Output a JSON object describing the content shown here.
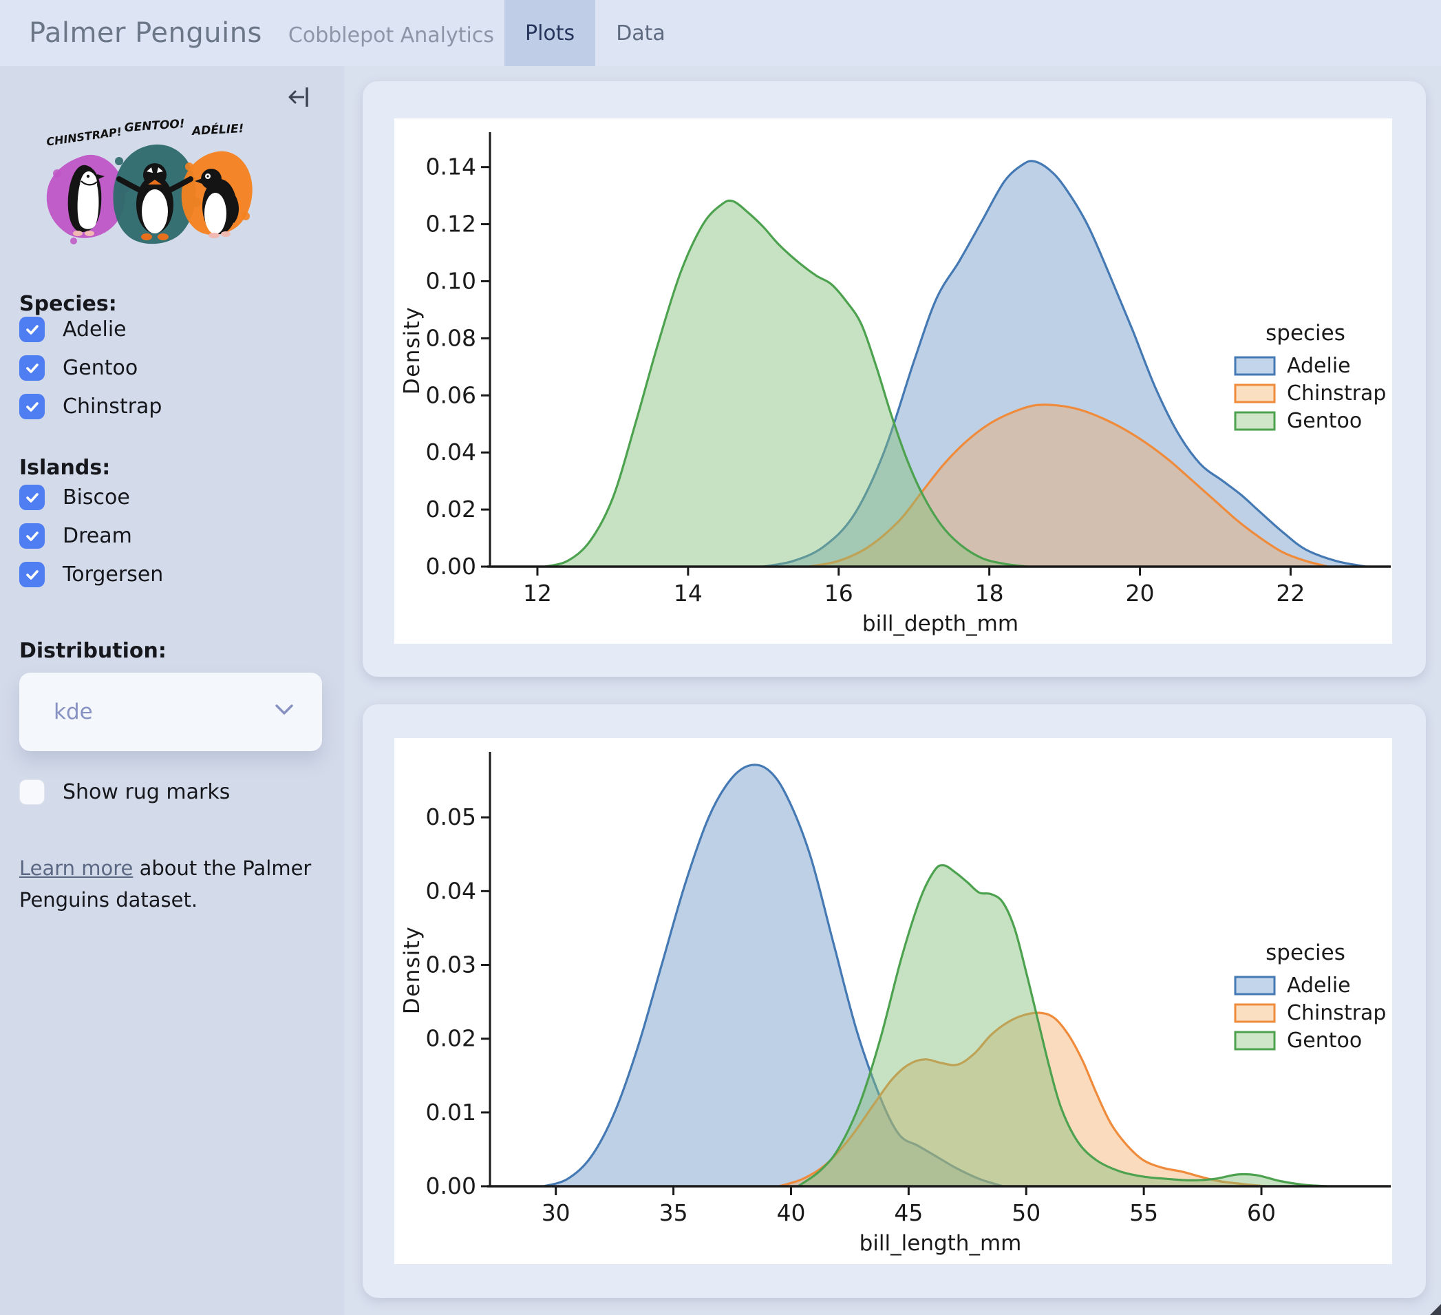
{
  "header": {
    "title": "Palmer Penguins",
    "subtitle": "Cobblepot Analytics",
    "tabs": [
      {
        "label": "Plots",
        "active": true
      },
      {
        "label": "Data",
        "active": false
      }
    ]
  },
  "theme": {
    "header_bg": "#dde4f3",
    "active_tab_bg": "#bfcde7",
    "sidebar_bg": "#d3dae9",
    "page_bg": "#d9e0ee",
    "card_bg": "#e4eaf6",
    "checkbox_accent": "#4e7ef1"
  },
  "sidebar": {
    "collapse_icon": "arrow-bar-left",
    "artwork": {
      "labels": [
        "CHINSTRAP!",
        "GENTOO!",
        "ADÉLIE!"
      ],
      "colors": {
        "chinstrap": "#bf53c5",
        "gentoo": "#2d6a6b",
        "adelie": "#f5821f"
      }
    },
    "species": {
      "label": "Species:",
      "options": [
        {
          "label": "Adelie",
          "checked": true
        },
        {
          "label": "Gentoo",
          "checked": true
        },
        {
          "label": "Chinstrap",
          "checked": true
        }
      ]
    },
    "islands": {
      "label": "Islands:",
      "options": [
        {
          "label": "Biscoe",
          "checked": true
        },
        {
          "label": "Dream",
          "checked": true
        },
        {
          "label": "Torgersen",
          "checked": true
        }
      ]
    },
    "distribution": {
      "label": "Distribution:",
      "value": "kde"
    },
    "rug": {
      "label": "Show rug marks",
      "checked": false
    },
    "footer": {
      "link_text": "Learn more",
      "text_after": " about the Palmer Penguins dataset."
    }
  },
  "chart_data": [
    {
      "type": "area",
      "subtype": "kde",
      "xlabel": "bill_depth_mm",
      "ylabel": "Density",
      "xlim": [
        11.37,
        23.33
      ],
      "ylim": [
        0,
        0.1515
      ],
      "xticks": [
        12,
        14,
        16,
        18,
        20,
        22
      ],
      "xtick_labels": [
        "12",
        "14",
        "16",
        "18",
        "20",
        "22"
      ],
      "yticks": [
        0,
        0.02,
        0.04,
        0.06,
        0.08,
        0.1,
        0.12,
        0.14
      ],
      "ytick_labels": [
        "0.00",
        "0.02",
        "0.04",
        "0.06",
        "0.08",
        "0.10",
        "0.12",
        "0.14"
      ],
      "grid": false,
      "legend": {
        "title": "species",
        "position": "center-right",
        "entries": [
          "Adelie",
          "Chinstrap",
          "Gentoo"
        ]
      },
      "series": [
        {
          "name": "Adelie",
          "color": "#4579b4",
          "fill": "rgba(108,150,200,0.45)",
          "legend_fill": "#c3d5ea",
          "points": [
            [
              15.0,
              0
            ],
            [
              15.4,
              0.002
            ],
            [
              15.8,
              0.007
            ],
            [
              16.2,
              0.018
            ],
            [
              16.6,
              0.04
            ],
            [
              17.0,
              0.072
            ],
            [
              17.3,
              0.094
            ],
            [
              17.6,
              0.107
            ],
            [
              17.9,
              0.121
            ],
            [
              18.2,
              0.135
            ],
            [
              18.45,
              0.141
            ],
            [
              18.6,
              0.142
            ],
            [
              18.8,
              0.139
            ],
            [
              19.0,
              0.133
            ],
            [
              19.3,
              0.12
            ],
            [
              19.6,
              0.102
            ],
            [
              19.9,
              0.083
            ],
            [
              20.2,
              0.063
            ],
            [
              20.5,
              0.047
            ],
            [
              20.8,
              0.036
            ],
            [
              21.1,
              0.03
            ],
            [
              21.35,
              0.025
            ],
            [
              21.6,
              0.019
            ],
            [
              21.9,
              0.012
            ],
            [
              22.2,
              0.006
            ],
            [
              22.6,
              0.002
            ],
            [
              23.0,
              0
            ]
          ]
        },
        {
          "name": "Chinstrap",
          "color": "#ef8b3b",
          "fill": "rgba(246,166,92,0.40)",
          "legend_fill": "#fadfc1",
          "points": [
            [
              15.6,
              0
            ],
            [
              16.0,
              0.002
            ],
            [
              16.4,
              0.007
            ],
            [
              16.8,
              0.016
            ],
            [
              17.1,
              0.026
            ],
            [
              17.4,
              0.036
            ],
            [
              17.7,
              0.044
            ],
            [
              18.0,
              0.05
            ],
            [
              18.3,
              0.054
            ],
            [
              18.6,
              0.0565
            ],
            [
              18.9,
              0.0565
            ],
            [
              19.2,
              0.055
            ],
            [
              19.5,
              0.052
            ],
            [
              19.8,
              0.048
            ],
            [
              20.1,
              0.043
            ],
            [
              20.4,
              0.037
            ],
            [
              20.7,
              0.03
            ],
            [
              21.0,
              0.023
            ],
            [
              21.3,
              0.016
            ],
            [
              21.6,
              0.01
            ],
            [
              21.9,
              0.005
            ],
            [
              22.2,
              0.002
            ],
            [
              22.5,
              0
            ]
          ]
        },
        {
          "name": "Gentoo",
          "color": "#4ca24e",
          "fill": "rgba(130,190,120,0.45)",
          "legend_fill": "#cfe6c8",
          "points": [
            [
              12.1,
              0
            ],
            [
              12.4,
              0.002
            ],
            [
              12.7,
              0.009
            ],
            [
              13.0,
              0.024
            ],
            [
              13.3,
              0.05
            ],
            [
              13.6,
              0.078
            ],
            [
              13.9,
              0.103
            ],
            [
              14.2,
              0.12
            ],
            [
              14.45,
              0.127
            ],
            [
              14.6,
              0.128
            ],
            [
              14.8,
              0.124
            ],
            [
              15.0,
              0.119
            ],
            [
              15.2,
              0.113
            ],
            [
              15.45,
              0.107
            ],
            [
              15.7,
              0.102
            ],
            [
              15.9,
              0.099
            ],
            [
              16.1,
              0.093
            ],
            [
              16.3,
              0.085
            ],
            [
              16.5,
              0.07
            ],
            [
              16.7,
              0.053
            ],
            [
              16.9,
              0.038
            ],
            [
              17.1,
              0.026
            ],
            [
              17.35,
              0.015
            ],
            [
              17.6,
              0.008
            ],
            [
              17.9,
              0.003
            ],
            [
              18.2,
              0.001
            ],
            [
              18.5,
              0
            ]
          ]
        }
      ]
    },
    {
      "type": "area",
      "subtype": "kde",
      "xlabel": "bill_length_mm",
      "ylabel": "Density",
      "xlim": [
        27.2,
        65.5
      ],
      "ylim": [
        0,
        0.0586
      ],
      "xticks": [
        30,
        35,
        40,
        45,
        50,
        55,
        60
      ],
      "xtick_labels": [
        "30",
        "35",
        "40",
        "45",
        "50",
        "55",
        "60"
      ],
      "yticks": [
        0,
        0.01,
        0.02,
        0.03,
        0.04,
        0.05
      ],
      "ytick_labels": [
        "0.00",
        "0.01",
        "0.02",
        "0.03",
        "0.04",
        "0.05"
      ],
      "grid": false,
      "legend": {
        "title": "species",
        "position": "center-right",
        "entries": [
          "Adelie",
          "Chinstrap",
          "Gentoo"
        ]
      },
      "series": [
        {
          "name": "Adelie",
          "color": "#4579b4",
          "fill": "rgba(108,150,200,0.45)",
          "legend_fill": "#c3d5ea",
          "points": [
            [
              29.5,
              0
            ],
            [
              30.5,
              0.001
            ],
            [
              31.5,
              0.004
            ],
            [
              32.5,
              0.01
            ],
            [
              33.5,
              0.019
            ],
            [
              34.5,
              0.03
            ],
            [
              35.5,
              0.041
            ],
            [
              36.5,
              0.05
            ],
            [
              37.4,
              0.055
            ],
            [
              38.2,
              0.057
            ],
            [
              39.0,
              0.0565
            ],
            [
              39.8,
              0.053
            ],
            [
              40.8,
              0.045
            ],
            [
              41.8,
              0.033
            ],
            [
              42.8,
              0.021
            ],
            [
              43.8,
              0.012
            ],
            [
              44.6,
              0.007
            ],
            [
              45.4,
              0.0055
            ],
            [
              46.2,
              0.004
            ],
            [
              47.0,
              0.0025
            ],
            [
              48.0,
              0.001
            ],
            [
              49.0,
              0
            ]
          ]
        },
        {
          "name": "Chinstrap",
          "color": "#ef8b3b",
          "fill": "rgba(246,166,92,0.40)",
          "legend_fill": "#fadfc1",
          "points": [
            [
              39.5,
              0
            ],
            [
              40.5,
              0.001
            ],
            [
              41.5,
              0.003
            ],
            [
              42.5,
              0.0065
            ],
            [
              43.5,
              0.011
            ],
            [
              44.3,
              0.0145
            ],
            [
              45.0,
              0.0165
            ],
            [
              45.7,
              0.0172
            ],
            [
              46.4,
              0.0167
            ],
            [
              47.1,
              0.0165
            ],
            [
              47.8,
              0.018
            ],
            [
              48.5,
              0.0205
            ],
            [
              49.2,
              0.0222
            ],
            [
              49.9,
              0.0232
            ],
            [
              50.6,
              0.0235
            ],
            [
              51.2,
              0.0228
            ],
            [
              51.8,
              0.0205
            ],
            [
              52.4,
              0.017
            ],
            [
              53.0,
              0.0125
            ],
            [
              53.6,
              0.0085
            ],
            [
              54.3,
              0.0055
            ],
            [
              55.0,
              0.0035
            ],
            [
              55.8,
              0.0025
            ],
            [
              56.6,
              0.002
            ],
            [
              57.4,
              0.0013
            ],
            [
              58.2,
              0.0007
            ],
            [
              59.2,
              0.0003
            ],
            [
              60.2,
              0
            ]
          ]
        },
        {
          "name": "Gentoo",
          "color": "#4ca24e",
          "fill": "rgba(130,190,120,0.45)",
          "legend_fill": "#cfe6c8",
          "points": [
            [
              40.3,
              0
            ],
            [
              41.2,
              0.002
            ],
            [
              42.0,
              0.005
            ],
            [
              42.9,
              0.011
            ],
            [
              43.8,
              0.02
            ],
            [
              44.7,
              0.031
            ],
            [
              45.5,
              0.039
            ],
            [
              46.1,
              0.0428
            ],
            [
              46.5,
              0.0435
            ],
            [
              47.0,
              0.0425
            ],
            [
              47.5,
              0.0412
            ],
            [
              48.0,
              0.0398
            ],
            [
              48.5,
              0.0396
            ],
            [
              49.0,
              0.0385
            ],
            [
              49.5,
              0.035
            ],
            [
              50.0,
              0.029
            ],
            [
              50.5,
              0.0225
            ],
            [
              51.0,
              0.016
            ],
            [
              51.5,
              0.0105
            ],
            [
              52.2,
              0.006
            ],
            [
              53.0,
              0.0035
            ],
            [
              54.0,
              0.002
            ],
            [
              55.0,
              0.0013
            ],
            [
              56.0,
              0.001
            ],
            [
              57.0,
              0.0008
            ],
            [
              58.0,
              0.001
            ],
            [
              59.0,
              0.0016
            ],
            [
              59.8,
              0.0015
            ],
            [
              60.8,
              0.0007
            ],
            [
              61.8,
              0.0002
            ],
            [
              62.8,
              0
            ]
          ]
        }
      ]
    }
  ]
}
